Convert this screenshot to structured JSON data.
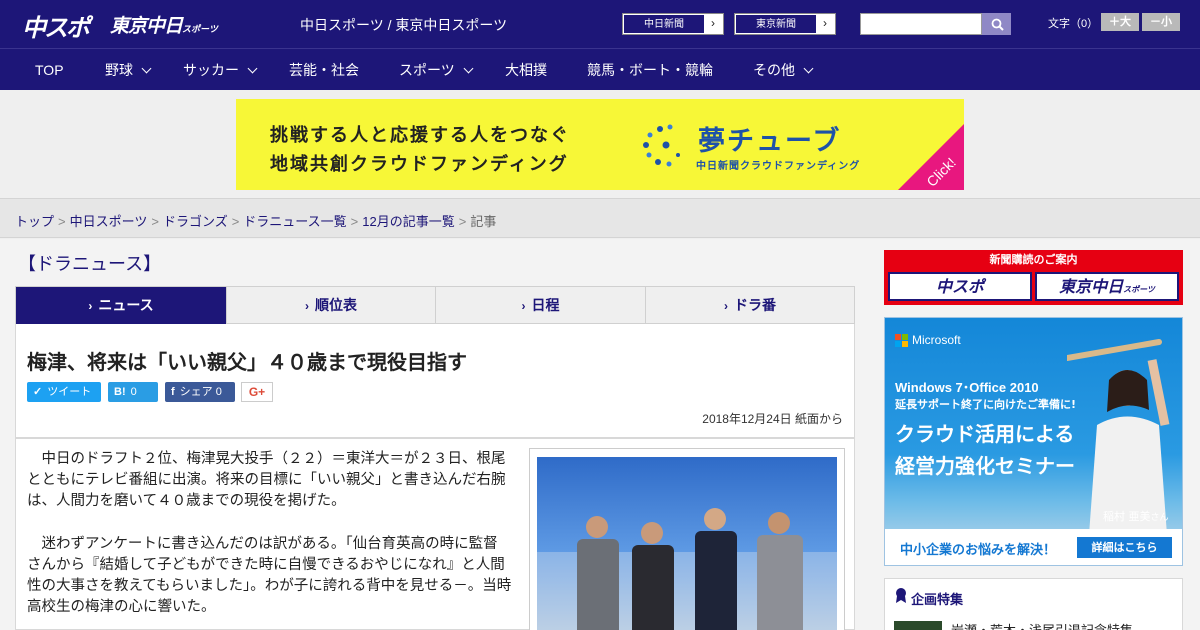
{
  "header": {
    "logo_chuspo": "中スポ",
    "logo_tokyo": "東京中日",
    "logo_tokyo_small": "スポーツ",
    "site_title": "中日スポーツ / 東京中日スポーツ",
    "ext_links": [
      {
        "label": "中日新聞",
        "arrow": "›"
      },
      {
        "label": "東京新聞",
        "arrow": "›"
      }
    ],
    "search_placeholder": "",
    "font_size_label": "文字（0）",
    "font_larger": "＋大",
    "font_smaller": "－小"
  },
  "nav": {
    "items": [
      {
        "label": "TOP",
        "dropdown": false
      },
      {
        "label": "野球",
        "dropdown": true
      },
      {
        "label": "サッカー",
        "dropdown": true
      },
      {
        "label": "芸能・社会",
        "dropdown": false
      },
      {
        "label": "スポーツ",
        "dropdown": true
      },
      {
        "label": "大相撲",
        "dropdown": false
      },
      {
        "label": "競馬・ボート・競輪",
        "dropdown": false
      },
      {
        "label": "その他",
        "dropdown": true
      }
    ]
  },
  "banner": {
    "line1": "挑戦する人と応援する人をつなぐ",
    "line2": "地域共創クラウドファンディング",
    "brand": "夢チューブ",
    "sub": "中日新聞クラウドファンディング",
    "click": "Click!",
    "bg_color": "#f7f737",
    "accent_color": "#e8177f"
  },
  "breadcrumb": {
    "items": [
      "トップ",
      "中日スポーツ",
      "ドラゴンズ",
      "ドラニュース一覧",
      "12月の記事一覧"
    ],
    "current": "記事",
    "separator": ">"
  },
  "section": {
    "title": "【ドラニュース】"
  },
  "tabs": [
    {
      "label": "ニュース",
      "active": true
    },
    {
      "label": "順位表",
      "active": false
    },
    {
      "label": "日程",
      "active": false
    },
    {
      "label": "ドラ番",
      "active": false
    }
  ],
  "article": {
    "headline": "梅津、将来は「いい親父」４０歳まで現役目指す",
    "share": {
      "tweet": "ツイート",
      "hatena_count": "0",
      "facebook": "シェア",
      "facebook_count": "0",
      "gplus": "G+"
    },
    "dateline": "2018年12月24日 紙面から",
    "paragraphs": [
      "中日のドラフト２位、梅津晃大投手（２２）＝東洋大＝が２３日、根尾とともにテレビ番組に出演。将来の目標に「いい親父」と書き込んだ右腕は、人間力を磨いて４０歳までの現役を掲げた。",
      "迷わずアンケートに書き込んだのは訳がある。「仙台育英高の時に監督さんから『結婚して子どもができた時に自慢できるおやじになれ』と人間性の大事さを教えてもらいました」。わが子に誇れる背中を見せる－。当時高校生の梅津の心に響いた。"
    ],
    "photo_alt": "photo"
  },
  "sidebar": {
    "subscribe_head": "新聞購読のご案内",
    "subscribe_buttons": [
      "中スポ",
      "東京中日"
    ],
    "subscribe_small": "スポーツ",
    "ad": {
      "brand": "Microsoft",
      "line1": "Windows 7･Office 2010",
      "line2": "延長サポート終了に向けたご準備に!",
      "line3": "クラウド活用による",
      "line4": "経営力強化セミナー",
      "name": "稲村 亜美",
      "name_suffix": "さん",
      "cta_text": "中小企業のお悩みを解決！",
      "cta_button": "詳細はこちら"
    },
    "kikaku_title": "企画特集",
    "kikaku_item": "岩瀬・荒木・浅尾引退記念特集"
  }
}
